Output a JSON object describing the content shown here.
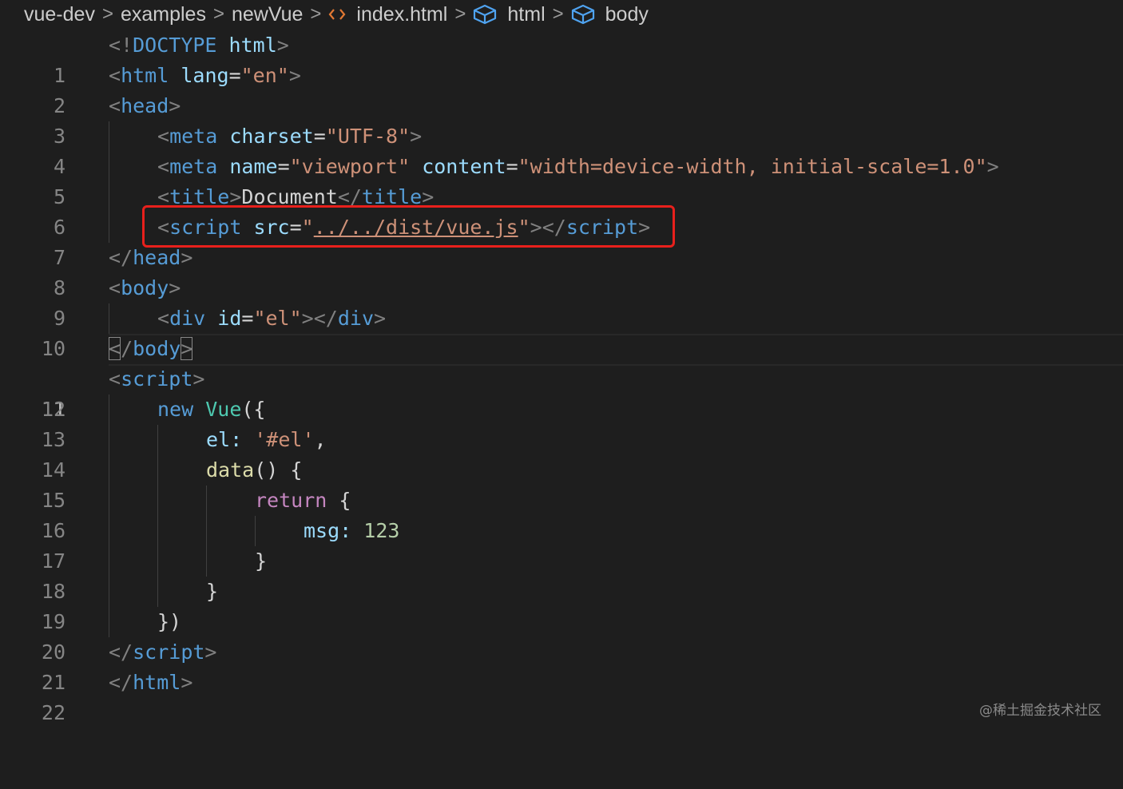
{
  "breadcrumb": {
    "items": [
      "vue-dev",
      "examples",
      "newVue",
      "index.html",
      "html",
      "body"
    ],
    "separator": ">"
  },
  "editor": {
    "line_numbers": [
      "1",
      "2",
      "3",
      "4",
      "5",
      "6",
      "7",
      "8",
      "9",
      "10",
      "11",
      "12",
      "13",
      "14",
      "15",
      "16",
      "17",
      "18",
      "19",
      "20",
      "21",
      "22"
    ],
    "highlighted_line": "7",
    "cursor_line": "11"
  },
  "tokens": {
    "lt": "<",
    "gt": ">",
    "lt_slash": "</",
    "eq": "=",
    "sp": " ",
    "excl": "!",
    "doctype": "DOCTYPE",
    "html_name": "html",
    "html": "html",
    "lang": "lang",
    "lang_val": "\"en\"",
    "head": "head",
    "meta": "meta",
    "charset": "charset",
    "charset_val": "\"UTF-8\"",
    "name": "name",
    "name_val": "\"viewport\"",
    "content": "content",
    "content_val": "\"width=device-width, initial-scale=1.0\"",
    "title": "title",
    "title_text": "Document",
    "script": "script",
    "src": "src",
    "quote": "\"",
    "src_val": "../../dist/vue.js",
    "body": "body",
    "div": "div",
    "id": "id",
    "id_val": "\"el\"",
    "new": "new",
    "vue": "Vue",
    "open": "({",
    "el_key": "el",
    "colon": ":",
    "el_val": "'#el'",
    "comma": ",",
    "data_fn": "data",
    "parens": "()",
    "brace_open": "{",
    "return": "return",
    "msg": "msg",
    "num": "123",
    "brace_close": "}",
    "close": "})"
  },
  "colors": {
    "background": "#1e1e1e",
    "tag": "#569cd6",
    "attribute": "#9cdcfe",
    "string": "#ce9178",
    "punctuation": "#808080",
    "control_keyword": "#c586c0",
    "class_name": "#4ec9b0",
    "function": "#dcdcaa",
    "number": "#b5cea8",
    "highlight_box": "#e8201c"
  },
  "icons": {
    "file": "html-file-icon",
    "symbol": "cube-icon"
  },
  "watermark": "@稀土掘金技术社区"
}
